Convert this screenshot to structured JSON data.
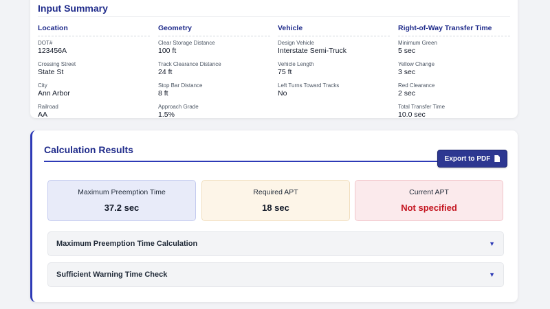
{
  "input_summary": {
    "title": "Input Summary",
    "columns": [
      {
        "heading": "Location",
        "fields": [
          {
            "label": "DOT#",
            "value": "123456A"
          },
          {
            "label": "Crossing Street",
            "value": "State St"
          },
          {
            "label": "City",
            "value": "Ann Arbor"
          },
          {
            "label": "Railroad",
            "value": "AA"
          }
        ]
      },
      {
        "heading": "Geometry",
        "fields": [
          {
            "label": "Clear Storage Distance",
            "value": "100 ft"
          },
          {
            "label": "Track Clearance Distance",
            "value": "24 ft"
          },
          {
            "label": "Stop Bar Distance",
            "value": "8 ft"
          },
          {
            "label": "Approach Grade",
            "value": "1.5%"
          }
        ]
      },
      {
        "heading": "Vehicle",
        "fields": [
          {
            "label": "Design Vehicle",
            "value": "Interstate Semi-Truck"
          },
          {
            "label": "Vehicle Length",
            "value": "75 ft"
          },
          {
            "label": "Left Turns Toward Tracks",
            "value": "No"
          }
        ]
      },
      {
        "heading": "Right-of-Way Transfer Time",
        "fields": [
          {
            "label": "Minimum Green",
            "value": "5 sec"
          },
          {
            "label": "Yellow Change",
            "value": "3 sec"
          },
          {
            "label": "Red Clearance",
            "value": "2 sec"
          },
          {
            "label": "Total Transfer Time",
            "value": "10.0 sec"
          }
        ]
      }
    ]
  },
  "results": {
    "title": "Calculation Results",
    "export_label": "Export to PDF",
    "metrics": [
      {
        "label": "Maximum Preemption Time",
        "value": "37.2 sec"
      },
      {
        "label": "Required APT",
        "value": "18 sec"
      },
      {
        "label": "Current APT",
        "value": "Not specified"
      }
    ],
    "sections": [
      {
        "label": "Maximum Preemption Time Calculation",
        "chevron": "▼"
      },
      {
        "label": "Sufficient Warning Time Check",
        "chevron": "▼"
      }
    ]
  },
  "icons": {
    "export": "document-icon",
    "expand": "chevron-down-icon"
  },
  "colors": {
    "accent": "#2d3ab6",
    "heading": "#1e2a8a",
    "danger": "#c4141f"
  }
}
